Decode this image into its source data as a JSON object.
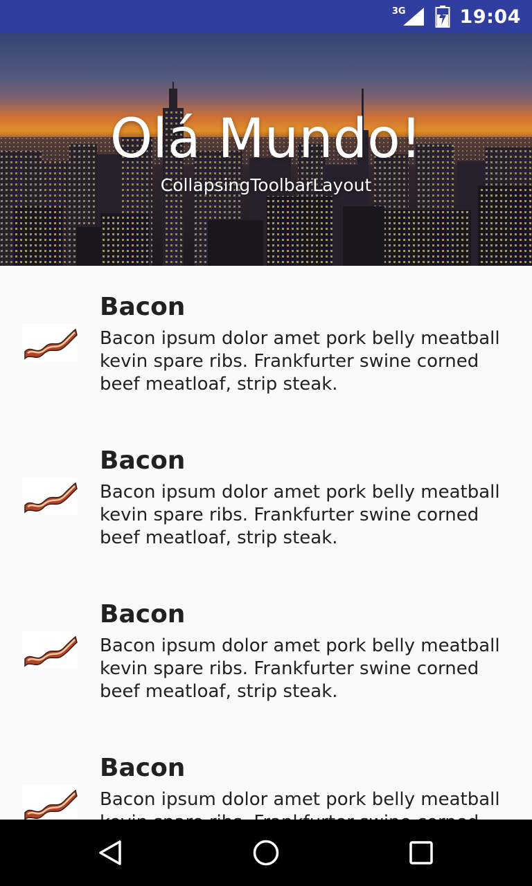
{
  "status_bar": {
    "network": "3G",
    "time": "19:04",
    "icons": [
      "signal-icon",
      "battery-icon"
    ]
  },
  "header": {
    "title": "Olá Mundo!",
    "subtitle": "CollapsingToolbarLayout"
  },
  "list": {
    "items": [
      {
        "icon": "bacon-icon",
        "title": "Bacon",
        "body": "Bacon ipsum dolor amet pork belly meatball kevin spare ribs. Frankfurter swine corned beef meatloaf, strip steak."
      },
      {
        "icon": "bacon-icon",
        "title": "Bacon",
        "body": "Bacon ipsum dolor amet pork belly meatball kevin spare ribs. Frankfurter swine corned beef meatloaf, strip steak."
      },
      {
        "icon": "bacon-icon",
        "title": "Bacon",
        "body": "Bacon ipsum dolor amet pork belly meatball kevin spare ribs. Frankfurter swine corned beef meatloaf, strip steak."
      },
      {
        "icon": "bacon-icon",
        "title": "Bacon",
        "body": "Bacon ipsum dolor amet pork belly meatball kevin spare ribs. Frankfurter swine corned beef meatloaf, strip steak."
      }
    ]
  },
  "nav_bar": {
    "buttons": [
      "back-icon",
      "home-icon",
      "recents-icon"
    ]
  },
  "colors": {
    "status_bar": "#303f9f",
    "background": "#fafafa",
    "text_primary": "#212121",
    "nav_bar": "#000000"
  }
}
